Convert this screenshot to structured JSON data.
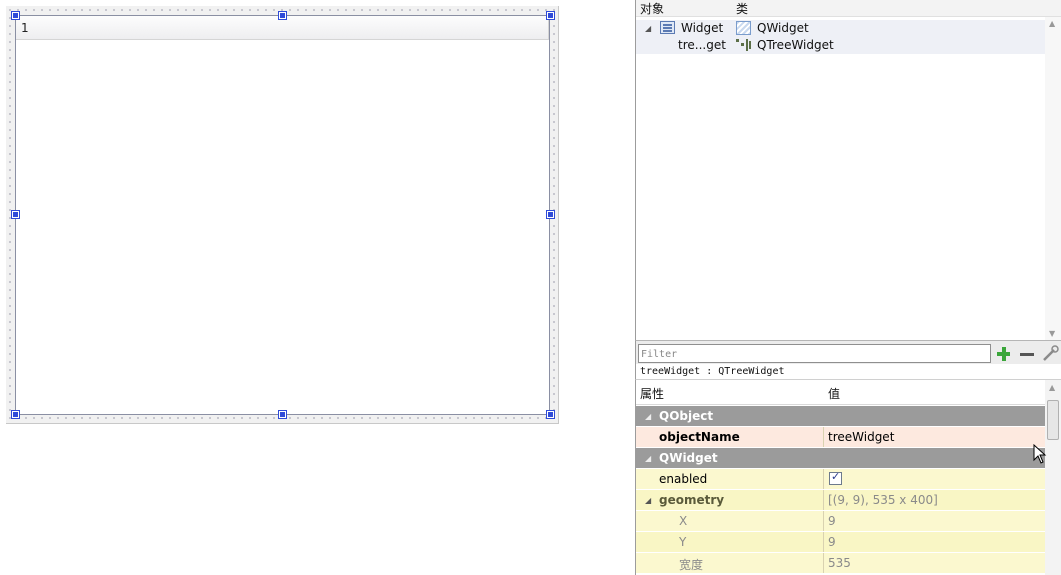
{
  "tree_widget": {
    "header_column": "1"
  },
  "object_inspector": {
    "col_object": "对象",
    "col_class": "类",
    "rows": [
      {
        "object": "Widget",
        "class": "QWidget",
        "expanded": true,
        "icon": "form-widget-icon",
        "class_icon": "qwidget-icon"
      },
      {
        "object": "tre...get",
        "class": "QTreeWidget",
        "icon": "",
        "class_icon": "qtreewidget-icon"
      }
    ]
  },
  "filter": {
    "placeholder": "Filter",
    "add_icon": "plus-icon",
    "remove_icon": "minus-icon",
    "configure_icon": "wrench-icon"
  },
  "property_editor": {
    "class_label": "treeWidget : QTreeWidget",
    "col_property": "属性",
    "col_value": "值",
    "rows": [
      {
        "type": "group",
        "name": "QObject"
      },
      {
        "type": "prop",
        "name": "objectName",
        "value": "treeWidget"
      },
      {
        "type": "group",
        "name": "QWidget"
      },
      {
        "type": "prop",
        "name": "enabled",
        "checked": true
      },
      {
        "type": "prop",
        "name": "geometry",
        "value": "[(9, 9), 535 x 400]"
      },
      {
        "type": "sub",
        "name": "X",
        "value": "9"
      },
      {
        "type": "sub",
        "name": "Y",
        "value": "9"
      },
      {
        "type": "sub",
        "name": "宽度",
        "value": "535"
      }
    ]
  },
  "colors": {
    "group_row": "#9b9b9b",
    "modified_row": "#fde9df",
    "property_row": "#fbf8cf",
    "selection_handle": "#2f4bd8"
  }
}
